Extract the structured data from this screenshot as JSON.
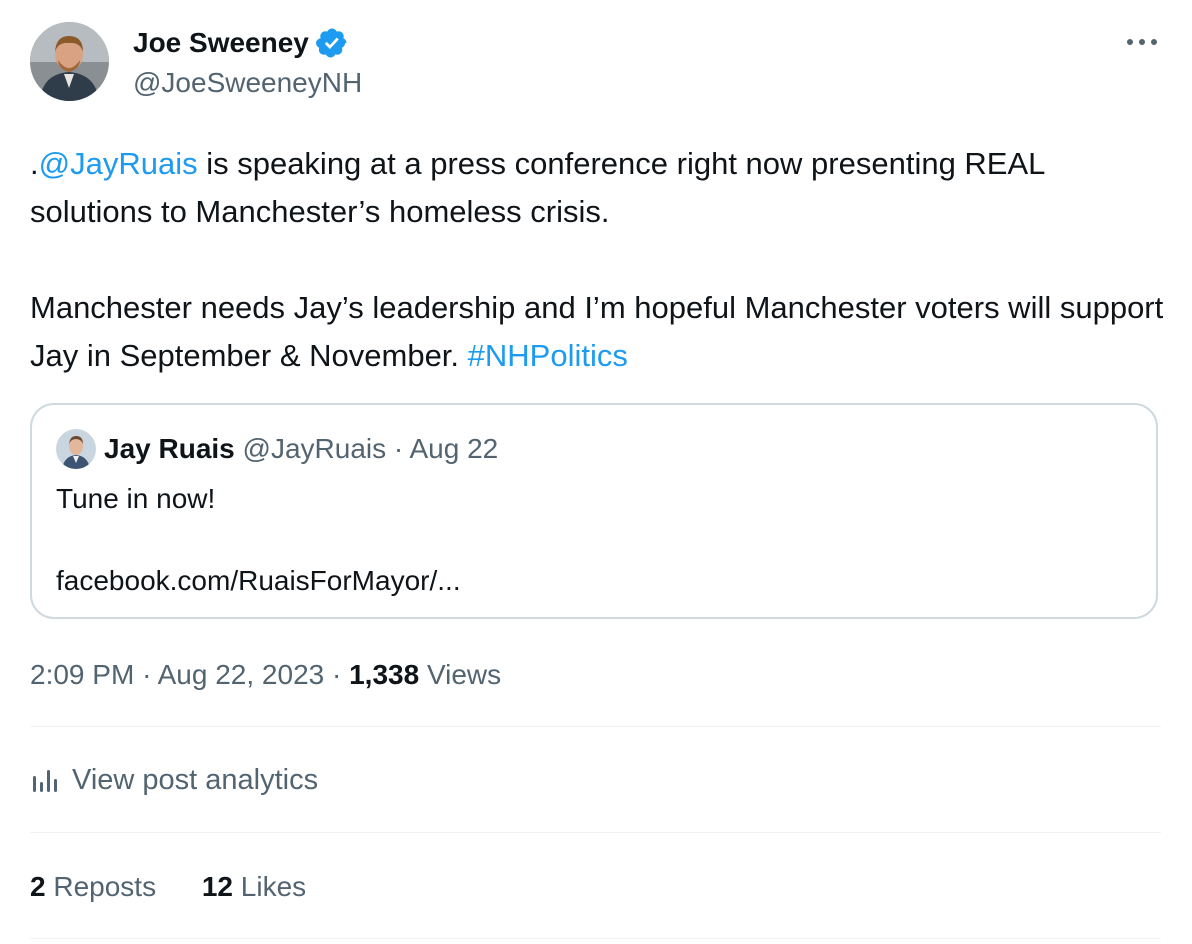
{
  "author": {
    "name": "Joe Sweeney",
    "handle": "@JoeSweeneyNH",
    "verified": true
  },
  "tweet": {
    "prefix": ".",
    "mention": "@JayRuais",
    "line1": " is speaking at a press conference right now presenting REAL solutions to Manchester’s homeless crisis.",
    "line2": "Manchester needs Jay’s leadership and I’m hopeful Manchester voters will support Jay in September & November. ",
    "hashtag": "#NHPolitics"
  },
  "quoted": {
    "name": "Jay Ruais",
    "handle": "@JayRuais",
    "date": "Aug 22",
    "text": "Tune in now!",
    "link": "facebook.com/RuaisForMayor/..."
  },
  "meta": {
    "time": "2:09 PM",
    "date": "Aug 22, 2023",
    "views_count": "1,338",
    "views_label": "Views"
  },
  "analytics_label": "View post analytics",
  "stats": {
    "reposts_count": "2",
    "reposts_label": "Reposts",
    "likes_count": "12",
    "likes_label": "Likes"
  },
  "colors": {
    "accent": "#1d9bf0",
    "secondary_text": "#536471",
    "border": "#cfd9de"
  }
}
